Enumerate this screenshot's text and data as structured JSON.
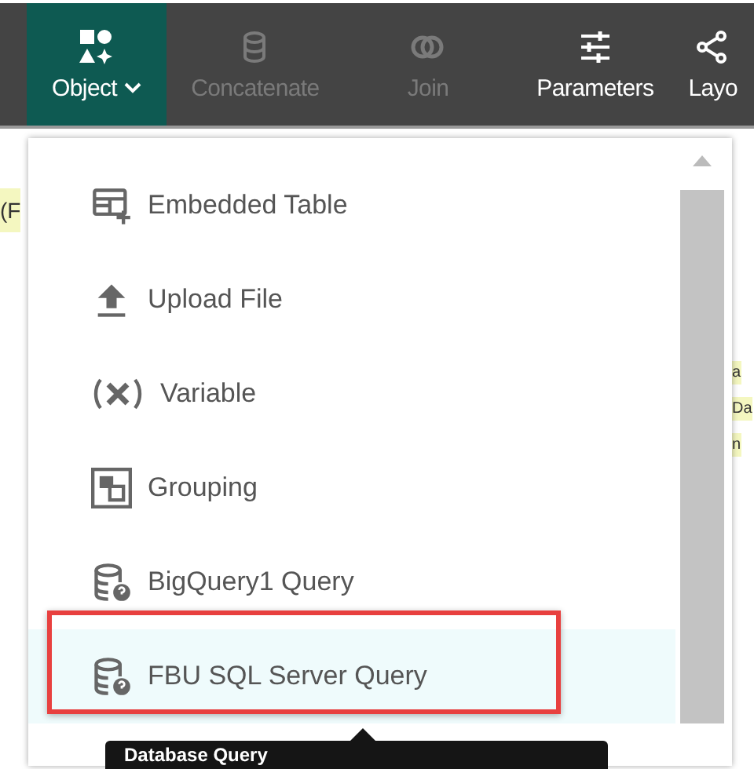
{
  "toolbar": [
    {
      "label": "Object",
      "selected": true,
      "disabled": false,
      "dropdown": true
    },
    {
      "label": "Concatenate",
      "selected": false,
      "disabled": true,
      "dropdown": false
    },
    {
      "label": "Join",
      "selected": false,
      "disabled": true,
      "dropdown": false
    },
    {
      "label": "Parameters",
      "selected": false,
      "disabled": false,
      "dropdown": false
    },
    {
      "label": "Layo",
      "selected": false,
      "disabled": false,
      "dropdown": false
    }
  ],
  "background": {
    "left_fragments": [
      "(F"
    ],
    "right_fragments": [
      "a",
      "Da",
      "n"
    ]
  },
  "menu": {
    "items": [
      {
        "label": "Embedded Table",
        "kind": "table",
        "selected": false
      },
      {
        "label": "Upload File",
        "kind": "upload",
        "selected": false
      },
      {
        "label": "Variable",
        "kind": "variable",
        "selected": false
      },
      {
        "label": "Grouping",
        "kind": "grouping",
        "selected": false
      },
      {
        "label": "BigQuery1 Query",
        "kind": "query",
        "selected": false
      },
      {
        "label": "FBU SQL Server Query",
        "kind": "query",
        "selected": true
      }
    ]
  },
  "tooltip": {
    "text": "Database Query"
  }
}
